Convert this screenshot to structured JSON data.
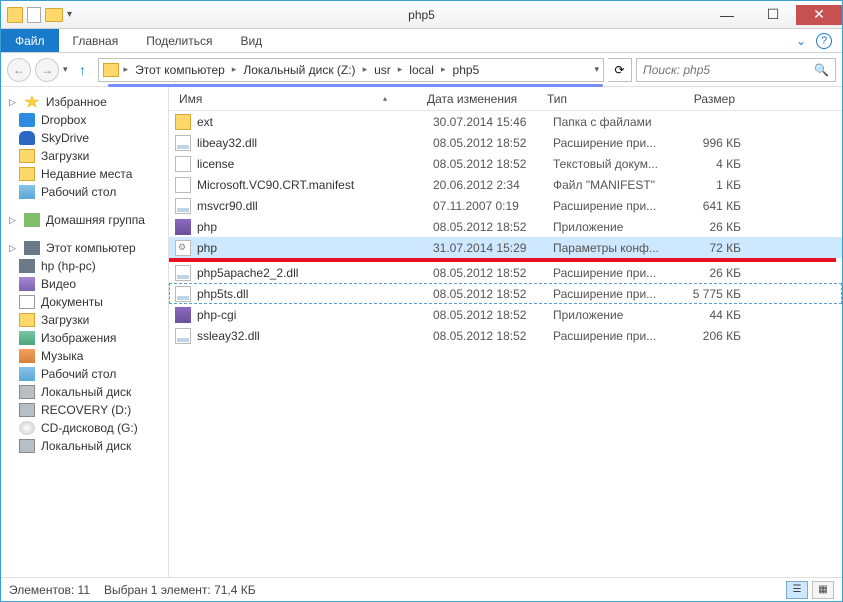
{
  "titlebar": {
    "title": "php5"
  },
  "ribbon": {
    "file": "Файл",
    "home": "Главная",
    "share": "Поделиться",
    "view": "Вид"
  },
  "breadcrumb": [
    "Этот компьютер",
    "Локальный диск (Z:)",
    "usr",
    "local",
    "php5"
  ],
  "search": {
    "placeholder": "Поиск: php5"
  },
  "sidebar": {
    "favorites": {
      "label": "Избранное",
      "items": [
        {
          "icon": "box",
          "label": "Dropbox"
        },
        {
          "icon": "cloud",
          "label": "SkyDrive"
        },
        {
          "icon": "folder",
          "label": "Загрузки"
        },
        {
          "icon": "folder",
          "label": "Недавние места"
        },
        {
          "icon": "desk",
          "label": "Рабочий стол"
        }
      ]
    },
    "homegroup": {
      "label": "Домашняя группа"
    },
    "thispc": {
      "label": "Этот компьютер",
      "items": [
        {
          "icon": "pc",
          "label": "hp (hp-pc)"
        },
        {
          "icon": "vid",
          "label": "Видео"
        },
        {
          "icon": "doc",
          "label": "Документы"
        },
        {
          "icon": "folder",
          "label": "Загрузки"
        },
        {
          "icon": "img",
          "label": "Изображения"
        },
        {
          "icon": "music",
          "label": "Музыка"
        },
        {
          "icon": "desk",
          "label": "Рабочий стол"
        },
        {
          "icon": "drive",
          "label": "Локальный диск"
        },
        {
          "icon": "drive",
          "label": "RECOVERY (D:)"
        },
        {
          "icon": "cd",
          "label": "CD-дисковод (G:)"
        },
        {
          "icon": "drive",
          "label": "Локальный диск"
        }
      ]
    }
  },
  "columns": {
    "name": "Имя",
    "date": "Дата изменения",
    "type": "Тип",
    "size": "Размер"
  },
  "files": [
    {
      "icon": "folder",
      "name": "ext",
      "date": "30.07.2014 15:46",
      "type": "Папка с файлами",
      "size": ""
    },
    {
      "icon": "dll",
      "name": "libeay32.dll",
      "date": "08.05.2012 18:52",
      "type": "Расширение при...",
      "size": "996 КБ"
    },
    {
      "icon": "txt",
      "name": "license",
      "date": "08.05.2012 18:52",
      "type": "Текстовый докум...",
      "size": "4 КБ"
    },
    {
      "icon": "txt",
      "name": "Microsoft.VC90.CRT.manifest",
      "date": "20.06.2012 2:34",
      "type": "Файл \"MANIFEST\"",
      "size": "1 КБ"
    },
    {
      "icon": "dll",
      "name": "msvcr90.dll",
      "date": "07.11.2007 0:19",
      "type": "Расширение при...",
      "size": "641 КБ"
    },
    {
      "icon": "app",
      "name": "php",
      "date": "08.05.2012 18:52",
      "type": "Приложение",
      "size": "26 КБ"
    },
    {
      "icon": "cfg",
      "name": "php",
      "date": "31.07.2014 15:29",
      "type": "Параметры конф...",
      "size": "72 КБ",
      "selected": true,
      "redline": true
    },
    {
      "icon": "dll",
      "name": "php5apache2_2.dll",
      "date": "08.05.2012 18:52",
      "type": "Расширение при...",
      "size": "26 КБ"
    },
    {
      "icon": "dll",
      "name": "php5ts.dll",
      "date": "08.05.2012 18:52",
      "type": "Расширение при...",
      "size": "5 775 КБ",
      "highlight": true
    },
    {
      "icon": "app",
      "name": "php-cgi",
      "date": "08.05.2012 18:52",
      "type": "Приложение",
      "size": "44 КБ"
    },
    {
      "icon": "dll",
      "name": "ssleay32.dll",
      "date": "08.05.2012 18:52",
      "type": "Расширение при...",
      "size": "206 КБ"
    }
  ],
  "status": {
    "count": "Элементов: 11",
    "selection": "Выбран 1 элемент: 71,4 КБ"
  }
}
